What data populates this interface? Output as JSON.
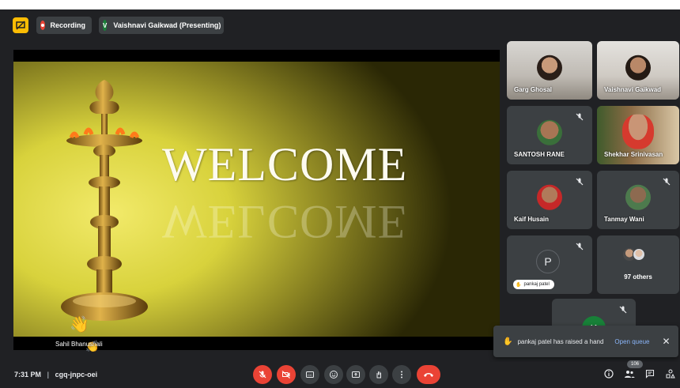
{
  "header": {
    "recording_label": "Recording",
    "presenter_initial": "V",
    "presenter_label": "Vaishnavi Gaikwad (Presenting)"
  },
  "slide": {
    "heading": "WELCOME",
    "speaker_name": "Sahil Bhanushali"
  },
  "participants": [
    {
      "name": "Garg Ghosal"
    },
    {
      "name": "Vaishnavi Gaikwad"
    },
    {
      "name": "SANTOSH RANE"
    },
    {
      "name": "Shekhar Srinivasan"
    },
    {
      "name": "Kaif Husain"
    },
    {
      "name": "Tanmay Wani"
    },
    {
      "initial": "P",
      "name": "pankaj patel"
    },
    {
      "name": "97 others"
    },
    {
      "initial": "K"
    }
  ],
  "toast": {
    "message": "pankaj patel has raised a hand",
    "action": "Open queue"
  },
  "footer": {
    "time": "7:31 PM",
    "separator": "|",
    "meeting_code": "cgq-jnpc-oei",
    "people_count": "106"
  },
  "colors": {
    "red": "#ea4335",
    "accent_blue": "#8ab4f8",
    "yellow": "#fbbc04"
  }
}
